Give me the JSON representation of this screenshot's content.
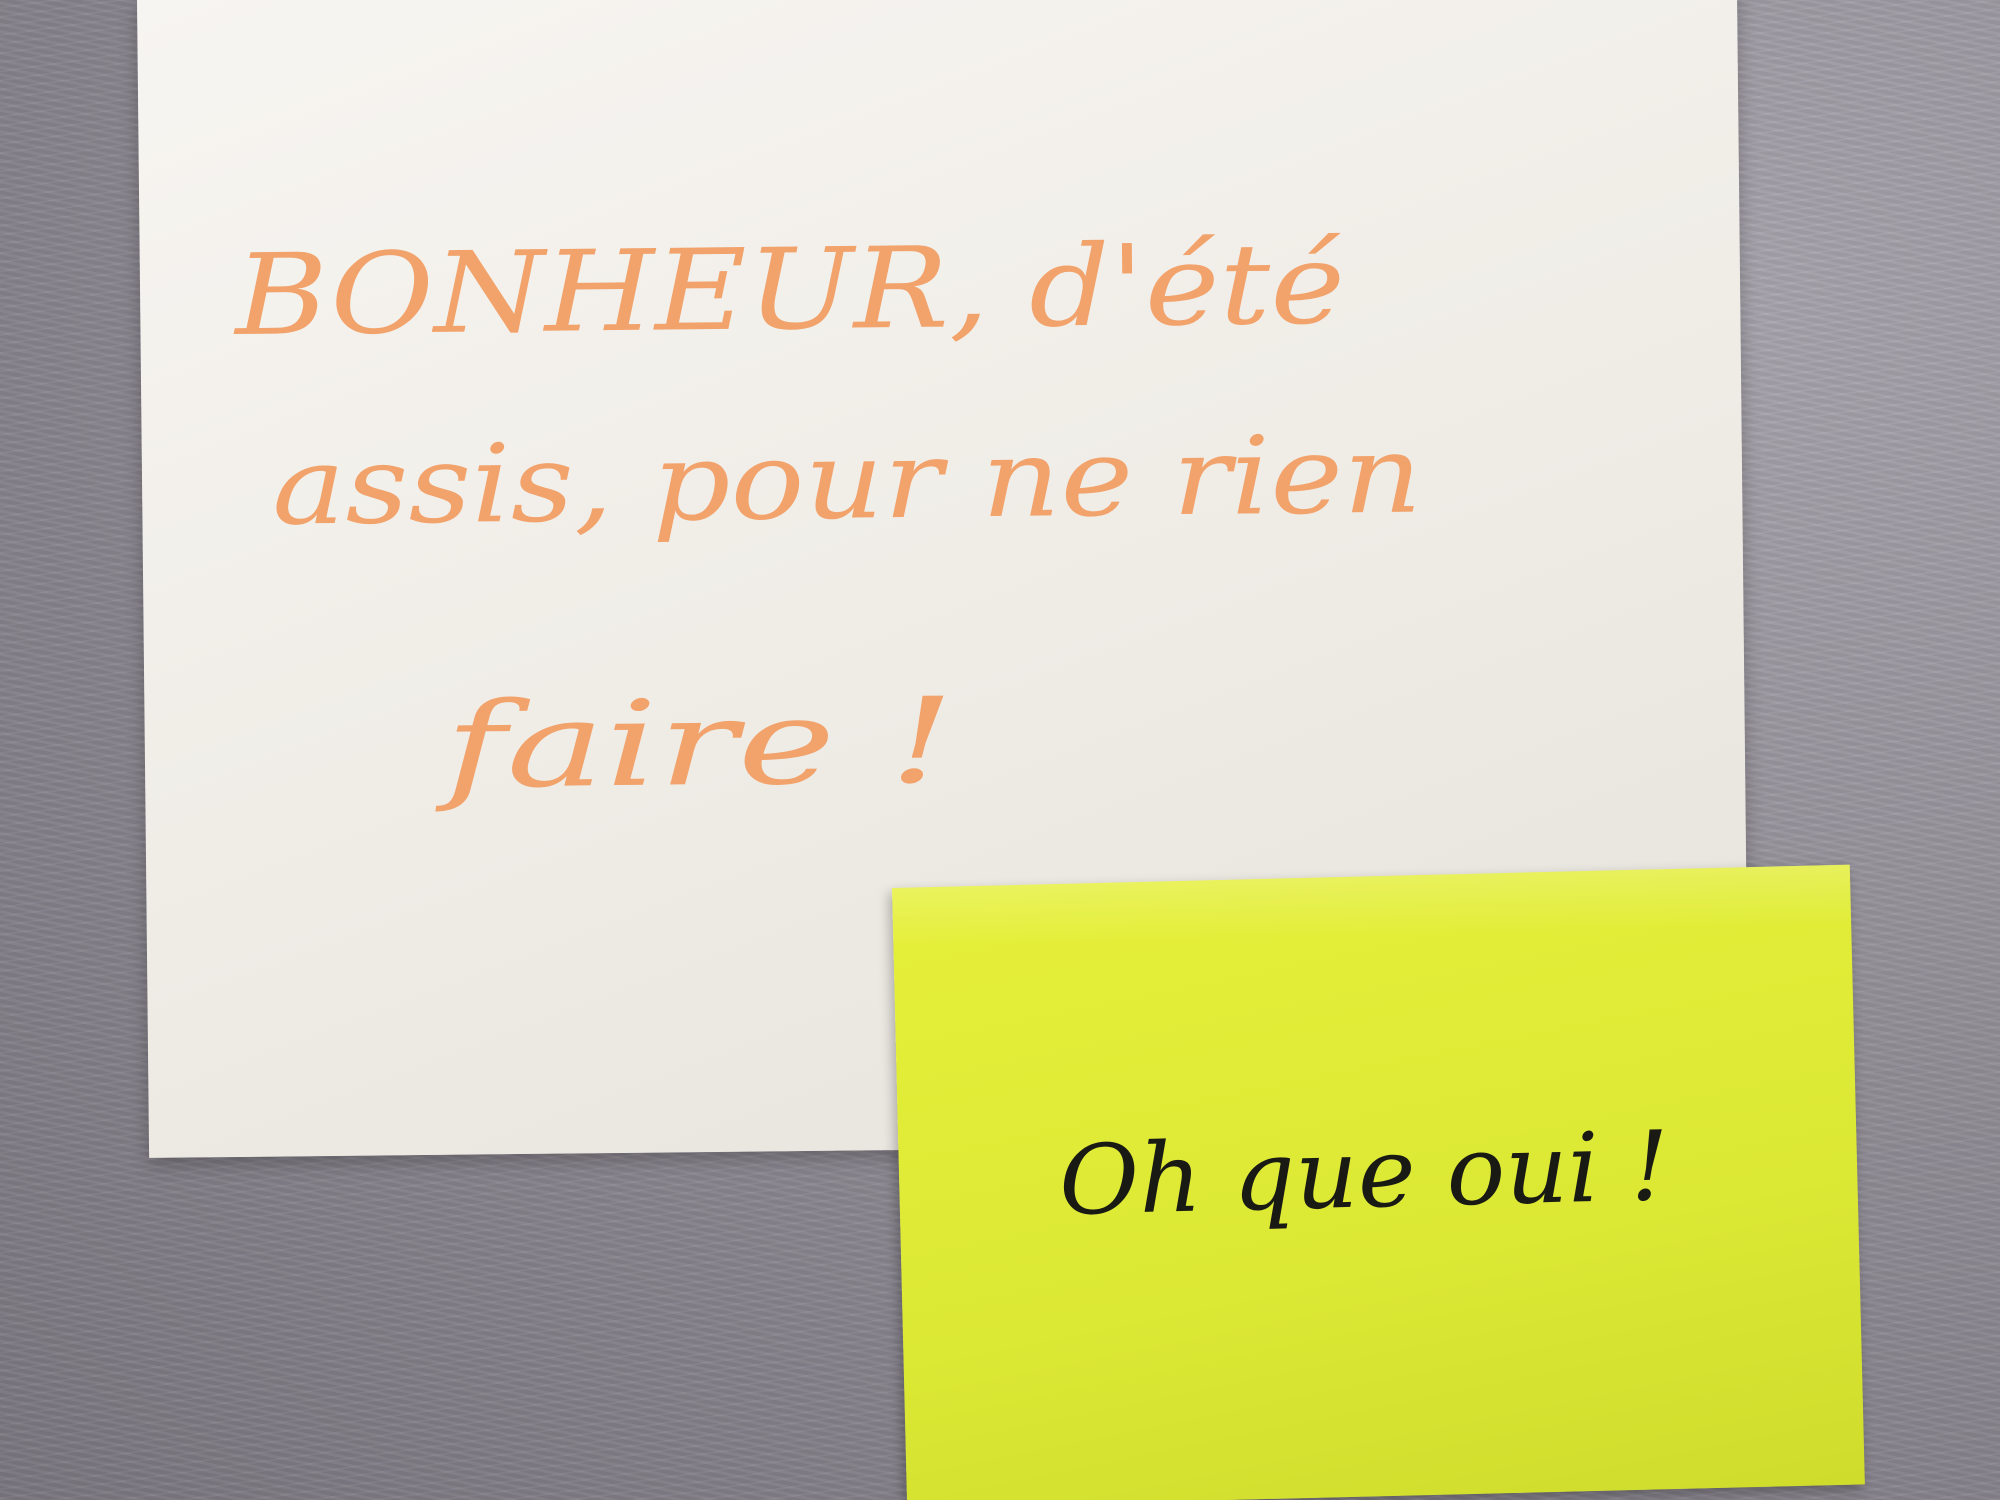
{
  "card": {
    "line1": "BONHEUR, d'été",
    "line2": "assis, pour ne rien",
    "line3": "faire !",
    "ink_color": "#f2a26b",
    "paper_color": "#f3f1ec"
  },
  "sticky_note": {
    "text": "Oh que oui !",
    "ink_color": "#1a1a14",
    "paper_color": "#e2ec38"
  },
  "background_color": "#8f8b94"
}
